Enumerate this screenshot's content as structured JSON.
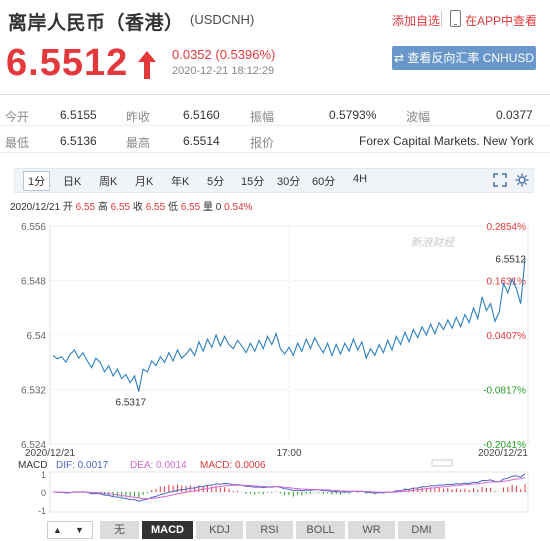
{
  "header": {
    "title": "离岸人民币（香港）",
    "symbol": "(USDCNH)",
    "add_favorite": "添加自选",
    "app_link": "在APP中查看"
  },
  "quote": {
    "price": "6.5512",
    "change": "0.0352 (0.5396%)",
    "time": "2020-12-21 18:12:29",
    "reverse_button": "查看反向汇率 CNHUSD",
    "color_up": "#e4393c"
  },
  "stats": {
    "open_label": "今开",
    "open": "6.5155",
    "prev_label": "昨收",
    "prev": "6.5160",
    "amp_label": "振幅",
    "amp": "0.5793%",
    "wave_label": "波幅",
    "wave": "0.0377",
    "low_label": "最低",
    "low": "6.5136",
    "high_label": "最高",
    "high": "6.5514",
    "quote_label": "报价",
    "quote_src": "Forex Capital Markets. New York"
  },
  "tabs": [
    "1分",
    "日K",
    "周K",
    "月K",
    "年K",
    "5分",
    "15分",
    "30分",
    "60分",
    "4H"
  ],
  "info_line": {
    "date": "2020/12/21",
    "open_label": "开",
    "open": "6.55",
    "high_label": "高",
    "high": "6.55",
    "close_label": "收",
    "close": "6.55",
    "low_label": "低",
    "low": "6.55",
    "vol_label": "量",
    "vol": "0",
    "pct": "0.54%"
  },
  "chart_data": {
    "type": "line",
    "y_ticks": [
      "6.556",
      "6.548",
      "6.54",
      "6.532",
      "6.524"
    ],
    "pct_ticks": [
      "0.2854%",
      "0.1631%",
      "0.0407%",
      "-0.0817%",
      "-0.2041%"
    ],
    "x_ticks": [
      "2020/12/21",
      "17:00",
      "2020/12/21"
    ],
    "ylim": [
      6.524,
      6.556
    ],
    "watermark": "新浪财经",
    "annotations": {
      "low": "6.5317",
      "last": "6.5512"
    },
    "values": [
      6.537,
      6.5365,
      6.5368,
      6.536,
      6.5372,
      6.5378,
      6.5366,
      6.5374,
      6.5362,
      6.5352,
      6.5366,
      6.536,
      6.5346,
      6.5355,
      6.534,
      6.535,
      6.5336,
      6.5342,
      6.533,
      6.534,
      6.5317,
      6.535,
      6.5346,
      6.5362,
      6.5355,
      6.5368,
      6.536,
      6.5374,
      6.5362,
      6.5378,
      6.5366,
      6.5372,
      6.538,
      6.537,
      6.539,
      6.5376,
      6.5394,
      6.5382,
      6.54,
      6.5384,
      6.5398,
      6.5386,
      6.538,
      6.5392,
      6.5384,
      6.5374,
      6.5388,
      6.5376,
      6.5392,
      6.538,
      6.5398,
      6.5386,
      6.5402,
      6.538,
      6.5372,
      6.5382,
      6.537,
      6.5388,
      6.5376,
      6.5394,
      6.538,
      6.5396,
      6.5384,
      6.5374,
      6.5388,
      6.537,
      6.5386,
      6.5372,
      6.5388,
      6.5376,
      6.5394,
      6.5378,
      6.539,
      6.5366,
      6.538,
      6.537,
      6.5386,
      6.5374,
      6.5392,
      6.5378,
      6.5398,
      6.5386,
      6.5404,
      6.539,
      6.5408,
      6.5396,
      6.5412,
      6.54,
      6.5416,
      6.5402,
      6.5418,
      6.5408,
      6.5422,
      6.541,
      6.5426,
      6.5412,
      6.543,
      6.5418,
      6.544,
      6.5424,
      6.5456,
      6.5436,
      6.5446,
      6.542,
      6.5434,
      6.5476,
      6.5462,
      6.5482,
      6.5468,
      6.5446,
      6.5512
    ],
    "macd": {
      "label": "MACD",
      "dif_label": "DIF: 0.0017",
      "dea_label": "DEA: 0.0014",
      "macd_label": "MACD: 0.0006",
      "y_ticks": [
        "1",
        "0",
        "-1"
      ],
      "dif_color": "#4a67c7",
      "dea_color": "#d46ad4"
    }
  },
  "bottom_tabs": [
    "无",
    "MACD",
    "KDJ",
    "RSI",
    "BOLL",
    "WR",
    "DMI"
  ],
  "nav": {
    "up": "▲",
    "down": "▼"
  }
}
